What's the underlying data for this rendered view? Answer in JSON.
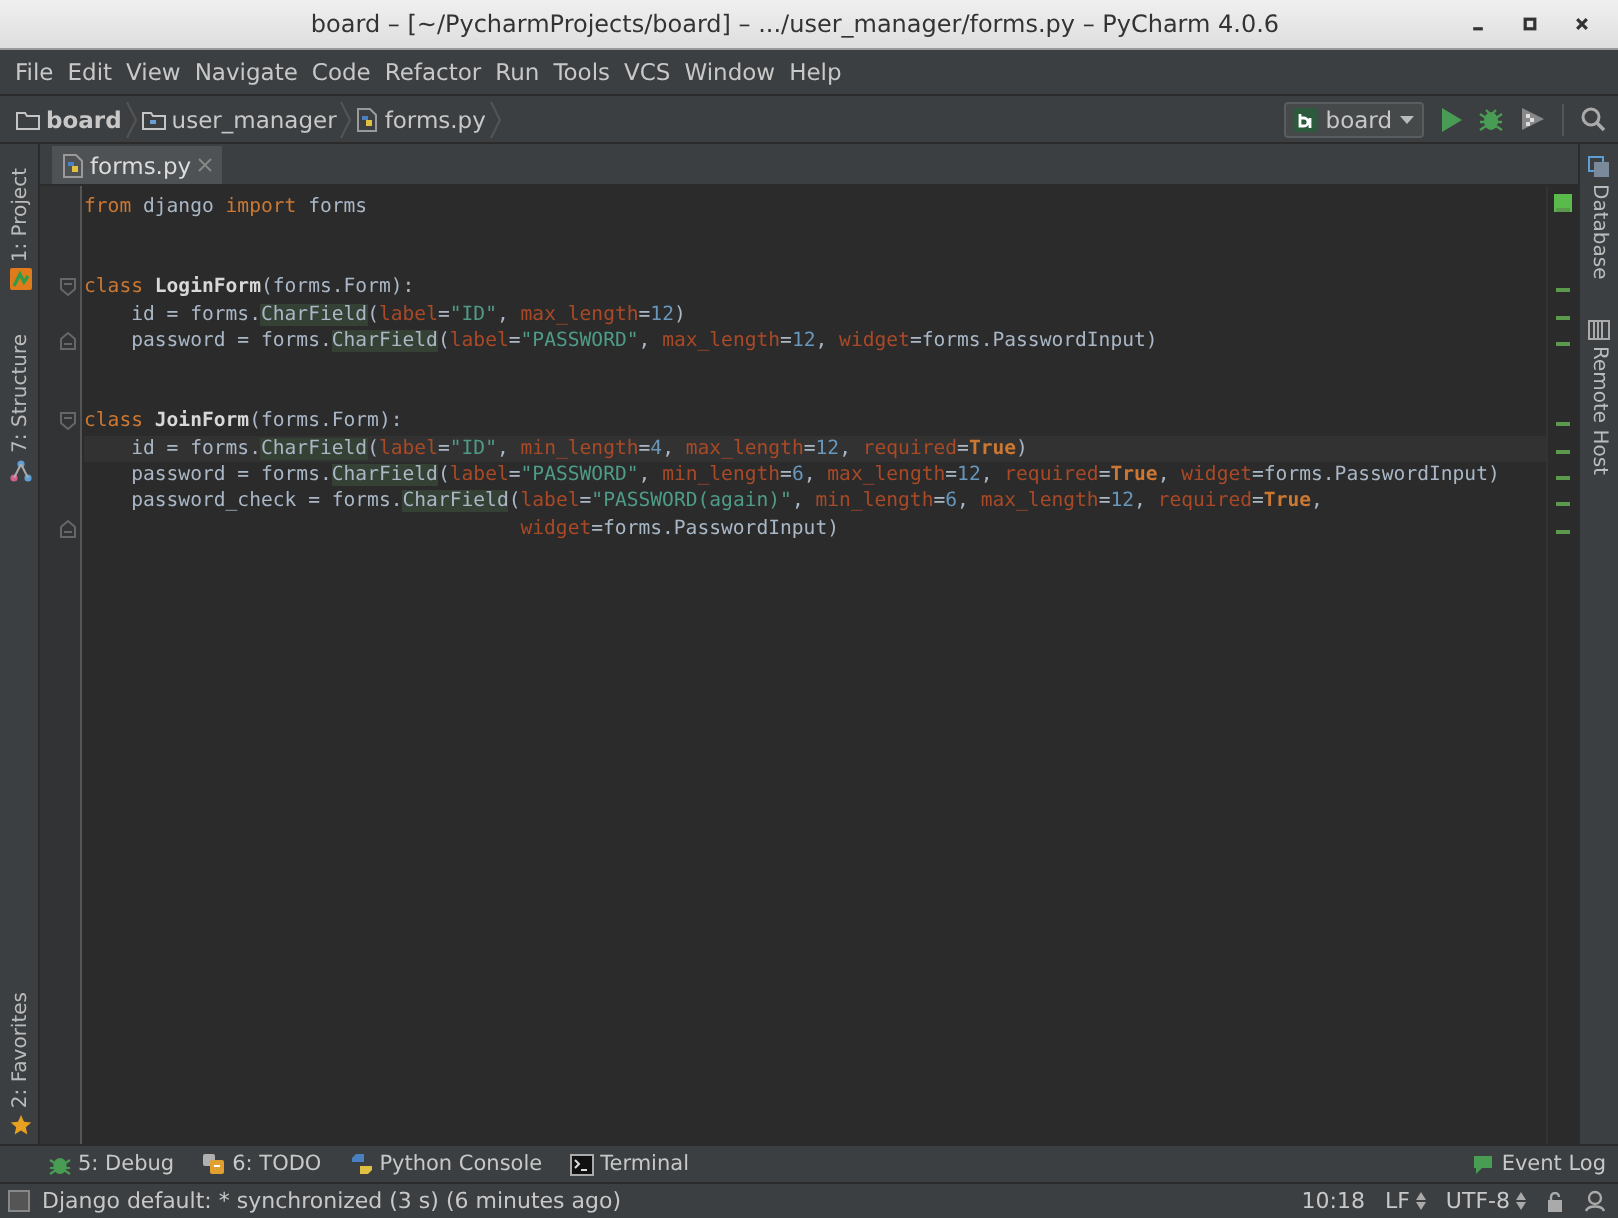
{
  "window": {
    "title": "board – [~/PycharmProjects/board] – .../user_manager/forms.py – PyCharm 4.0.6"
  },
  "menu": [
    "File",
    "Edit",
    "View",
    "Navigate",
    "Code",
    "Refactor",
    "Run",
    "Tools",
    "VCS",
    "Window",
    "Help"
  ],
  "breadcrumbs": [
    {
      "label": "board",
      "kind": "folder"
    },
    {
      "label": "user_manager",
      "kind": "module"
    },
    {
      "label": "forms.py",
      "kind": "python"
    }
  ],
  "run_config": {
    "label": "board"
  },
  "tabs": [
    {
      "label": "forms.py",
      "selected": true
    }
  ],
  "left_tools": [
    {
      "label": "1: Project",
      "kind": "project"
    },
    {
      "label": "7: Structure",
      "kind": "structure"
    }
  ],
  "left_bottom_tools": [
    {
      "label": "2: Favorites",
      "kind": "favorites"
    }
  ],
  "right_tools": [
    {
      "label": "Database",
      "kind": "database"
    },
    {
      "label": "Remote Host",
      "kind": "remote"
    }
  ],
  "code": [
    {
      "kind": "code",
      "tokens": [
        {
          "kind": "kw",
          "text": "from"
        },
        {
          "kind": "plain",
          "text": " django "
        },
        {
          "kind": "kw",
          "text": "import"
        },
        {
          "kind": "plain",
          "text": " forms"
        }
      ]
    },
    {
      "kind": "blank"
    },
    {
      "kind": "blank"
    },
    {
      "kind": "code",
      "fold_start": true,
      "tokens": [
        {
          "kind": "kw",
          "text": "class "
        },
        {
          "kind": "name",
          "text": "LoginForm"
        },
        {
          "kind": "plain",
          "text": "(forms.Form):"
        }
      ]
    },
    {
      "kind": "code",
      "tokens": [
        {
          "kind": "plain",
          "text": "    id = forms."
        },
        {
          "kind": "ref",
          "text": "CharField"
        },
        {
          "kind": "plain",
          "text": "("
        },
        {
          "kind": "param",
          "text": "label"
        },
        {
          "kind": "plain",
          "text": "="
        },
        {
          "kind": "str",
          "text": "\"ID\""
        },
        {
          "kind": "plain",
          "text": ", "
        },
        {
          "kind": "param",
          "text": "max_length"
        },
        {
          "kind": "plain",
          "text": "="
        },
        {
          "kind": "num",
          "text": "12"
        },
        {
          "kind": "plain",
          "text": ")"
        }
      ]
    },
    {
      "kind": "code",
      "fold_end": true,
      "tokens": [
        {
          "kind": "plain",
          "text": "    password = forms."
        },
        {
          "kind": "ref",
          "text": "CharField"
        },
        {
          "kind": "plain",
          "text": "("
        },
        {
          "kind": "param",
          "text": "label"
        },
        {
          "kind": "plain",
          "text": "="
        },
        {
          "kind": "str",
          "text": "\"PASSWORD\""
        },
        {
          "kind": "plain",
          "text": ", "
        },
        {
          "kind": "param",
          "text": "max_length"
        },
        {
          "kind": "plain",
          "text": "="
        },
        {
          "kind": "num",
          "text": "12"
        },
        {
          "kind": "plain",
          "text": ", "
        },
        {
          "kind": "param",
          "text": "widget"
        },
        {
          "kind": "plain",
          "text": "=forms.PasswordInput)"
        }
      ]
    },
    {
      "kind": "blank"
    },
    {
      "kind": "blank"
    },
    {
      "kind": "code",
      "fold_start": true,
      "tokens": [
        {
          "kind": "kw",
          "text": "class "
        },
        {
          "kind": "name",
          "text": "JoinForm"
        },
        {
          "kind": "plain",
          "text": "(forms.Form):"
        }
      ]
    },
    {
      "kind": "code",
      "current": true,
      "tokens": [
        {
          "kind": "plain",
          "text": "    id = forms."
        },
        {
          "kind": "ref",
          "text": "CharField"
        },
        {
          "kind": "plain",
          "text": "("
        },
        {
          "kind": "param",
          "text": "label"
        },
        {
          "kind": "plain",
          "text": "="
        },
        {
          "kind": "str",
          "text": "\"ID\""
        },
        {
          "kind": "plain",
          "text": ", "
        },
        {
          "kind": "param",
          "text": "min_length"
        },
        {
          "kind": "plain",
          "text": "="
        },
        {
          "kind": "num",
          "text": "4"
        },
        {
          "kind": "plain",
          "text": ", "
        },
        {
          "kind": "param",
          "text": "max_length"
        },
        {
          "kind": "plain",
          "text": "="
        },
        {
          "kind": "num",
          "text": "12"
        },
        {
          "kind": "plain",
          "text": ", "
        },
        {
          "kind": "param",
          "text": "required"
        },
        {
          "kind": "plain",
          "text": "="
        },
        {
          "kind": "const",
          "text": "True"
        },
        {
          "kind": "plain",
          "text": ")"
        }
      ]
    },
    {
      "kind": "code",
      "tokens": [
        {
          "kind": "plain",
          "text": "    password = forms."
        },
        {
          "kind": "ref",
          "text": "CharField"
        },
        {
          "kind": "plain",
          "text": "("
        },
        {
          "kind": "param",
          "text": "label"
        },
        {
          "kind": "plain",
          "text": "="
        },
        {
          "kind": "str",
          "text": "\"PASSWORD\""
        },
        {
          "kind": "plain",
          "text": ", "
        },
        {
          "kind": "param",
          "text": "min_length"
        },
        {
          "kind": "plain",
          "text": "="
        },
        {
          "kind": "num",
          "text": "6"
        },
        {
          "kind": "plain",
          "text": ", "
        },
        {
          "kind": "param",
          "text": "max_length"
        },
        {
          "kind": "plain",
          "text": "="
        },
        {
          "kind": "num",
          "text": "12"
        },
        {
          "kind": "plain",
          "text": ", "
        },
        {
          "kind": "param",
          "text": "required"
        },
        {
          "kind": "plain",
          "text": "="
        },
        {
          "kind": "const",
          "text": "True"
        },
        {
          "kind": "plain",
          "text": ", "
        },
        {
          "kind": "param",
          "text": "widget"
        },
        {
          "kind": "plain",
          "text": "=forms.PasswordInput)"
        }
      ]
    },
    {
      "kind": "code",
      "tokens": [
        {
          "kind": "plain",
          "text": "    password_check = forms."
        },
        {
          "kind": "ref",
          "text": "CharField"
        },
        {
          "kind": "plain",
          "text": "("
        },
        {
          "kind": "param",
          "text": "label"
        },
        {
          "kind": "plain",
          "text": "="
        },
        {
          "kind": "str",
          "text": "\"PASSWORD(again)\""
        },
        {
          "kind": "plain",
          "text": ", "
        },
        {
          "kind": "param",
          "text": "min_length"
        },
        {
          "kind": "plain",
          "text": "="
        },
        {
          "kind": "num",
          "text": "6"
        },
        {
          "kind": "plain",
          "text": ", "
        },
        {
          "kind": "param",
          "text": "max_length"
        },
        {
          "kind": "plain",
          "text": "="
        },
        {
          "kind": "num",
          "text": "12"
        },
        {
          "kind": "plain",
          "text": ", "
        },
        {
          "kind": "param",
          "text": "required"
        },
        {
          "kind": "plain",
          "text": "="
        },
        {
          "kind": "const",
          "text": "True"
        },
        {
          "kind": "plain",
          "text": ","
        }
      ]
    },
    {
      "kind": "code",
      "fold_end": true,
      "tokens": [
        {
          "kind": "param",
          "text": "                                     widget"
        },
        {
          "kind": "plain",
          "text": "=forms.PasswordInput)"
        }
      ]
    }
  ],
  "bottom_tools": [
    {
      "label": "5: Debug",
      "kind": "debug"
    },
    {
      "label": "6: TODO",
      "kind": "todo"
    },
    {
      "label": "Python Console",
      "kind": "console"
    },
    {
      "label": "Terminal",
      "kind": "terminal"
    }
  ],
  "event_log": {
    "label": "Event Log"
  },
  "status_bar": {
    "message": "Django default: * synchronized (3 s) (6 minutes ago)",
    "position": "10:18",
    "line_separator": "LF",
    "encoding": "UTF-8"
  }
}
